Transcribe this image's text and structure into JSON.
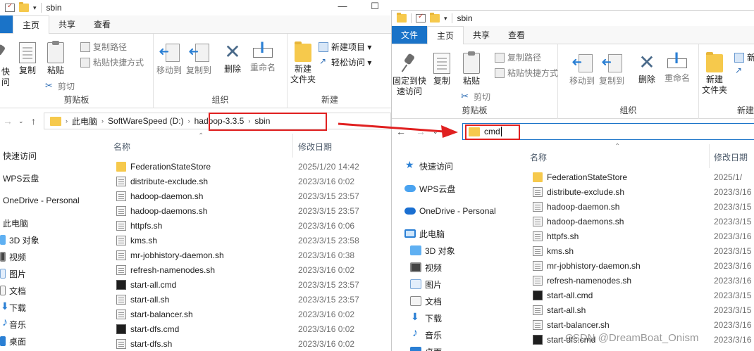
{
  "left_window": {
    "title": "sbin",
    "tabs": [
      "主页",
      "共享",
      "查看"
    ],
    "ribbon": {
      "clipboard": {
        "pin_label": "快\n问",
        "copy": "复制",
        "paste": "粘贴",
        "copy_path": "复制路径",
        "paste_shortcut": "粘贴快捷方式",
        "cut": "剪切",
        "group": "剪贴板"
      },
      "organize": {
        "move_to": "移动到",
        "copy_to": "复制到",
        "delete": "删除",
        "rename": "重命名",
        "group": "组织"
      },
      "new": {
        "new_folder": "新建\n文件夹",
        "new_item": "新建项目 ▾",
        "easy_access": "轻松访问 ▾",
        "group": "新建"
      }
    },
    "address": {
      "crumbs": [
        "此电脑",
        "SoftWareSpeed (D:)",
        "hadoop-3.3.5",
        "sbin"
      ]
    },
    "nav": [
      "快速访问",
      "WPS云盘",
      "OneDrive - Personal",
      "此电脑",
      "3D 对象",
      "视频",
      "图片",
      "文档",
      "下载",
      "音乐",
      "桌面"
    ],
    "columns": {
      "name": "名称",
      "date": "修改日期"
    },
    "files": [
      {
        "name": "FederationStateStore",
        "date": "2025/1/20 14:42",
        "type": "folder"
      },
      {
        "name": "distribute-exclude.sh",
        "date": "2023/3/16 0:02",
        "type": "sh"
      },
      {
        "name": "hadoop-daemon.sh",
        "date": "2023/3/15 23:57",
        "type": "sh"
      },
      {
        "name": "hadoop-daemons.sh",
        "date": "2023/3/15 23:57",
        "type": "sh"
      },
      {
        "name": "httpfs.sh",
        "date": "2023/3/16 0:06",
        "type": "sh"
      },
      {
        "name": "kms.sh",
        "date": "2023/3/15 23:58",
        "type": "sh"
      },
      {
        "name": "mr-jobhistory-daemon.sh",
        "date": "2023/3/16 0:38",
        "type": "sh"
      },
      {
        "name": "refresh-namenodes.sh",
        "date": "2023/3/16 0:02",
        "type": "sh"
      },
      {
        "name": "start-all.cmd",
        "date": "2023/3/15 23:57",
        "type": "cmd"
      },
      {
        "name": "start-all.sh",
        "date": "2023/3/15 23:57",
        "type": "sh"
      },
      {
        "name": "start-balancer.sh",
        "date": "2023/3/16 0:02",
        "type": "sh"
      },
      {
        "name": "start-dfs.cmd",
        "date": "2023/3/16 0:02",
        "type": "cmd"
      },
      {
        "name": "start-dfs.sh",
        "date": "2023/3/16 0:02",
        "type": "sh"
      }
    ]
  },
  "right_window": {
    "title": "sbin",
    "tabs": [
      "文件",
      "主页",
      "共享",
      "查看"
    ],
    "ribbon": {
      "clipboard": {
        "pin": "固定到快\n速访问",
        "copy": "复制",
        "paste": "粘贴",
        "copy_path": "复制路径",
        "paste_shortcut": "粘贴快捷方式",
        "cut": "剪切",
        "group": "剪贴板"
      },
      "organize": {
        "move_to": "移动到",
        "copy_to": "复制到",
        "delete": "删除",
        "rename": "重命名",
        "group": "组织"
      },
      "new": {
        "new_folder": "新建\n文件夹",
        "new_item": "新",
        "group": "新建"
      }
    },
    "address_value": "cmd",
    "nav": [
      "快速访问",
      "WPS云盘",
      "OneDrive - Personal",
      "此电脑",
      "3D 对象",
      "视频",
      "图片",
      "文档",
      "下载",
      "音乐",
      "桌面"
    ],
    "columns": {
      "name": "名称",
      "date": "修改日期"
    },
    "files": [
      {
        "name": "FederationStateStore",
        "date": "2025/1/",
        "type": "folder"
      },
      {
        "name": "distribute-exclude.sh",
        "date": "2023/3/16",
        "type": "sh"
      },
      {
        "name": "hadoop-daemon.sh",
        "date": "2023/3/15",
        "type": "sh"
      },
      {
        "name": "hadoop-daemons.sh",
        "date": "2023/3/15",
        "type": "sh"
      },
      {
        "name": "httpfs.sh",
        "date": "2023/3/16",
        "type": "sh"
      },
      {
        "name": "kms.sh",
        "date": "2023/3/15",
        "type": "sh"
      },
      {
        "name": "mr-jobhistory-daemon.sh",
        "date": "2023/3/16",
        "type": "sh"
      },
      {
        "name": "refresh-namenodes.sh",
        "date": "2023/3/16",
        "type": "sh"
      },
      {
        "name": "start-all.cmd",
        "date": "2023/3/15",
        "type": "cmd"
      },
      {
        "name": "start-all.sh",
        "date": "2023/3/15",
        "type": "sh"
      },
      {
        "name": "start-balancer.sh",
        "date": "2023/3/16",
        "type": "sh"
      },
      {
        "name": "start-dfs.cmd",
        "date": "2023/3/16",
        "type": "cmd"
      }
    ]
  },
  "watermark": "CSDN @DreamBoat_Onism",
  "colors": {
    "accent": "#1a73c8",
    "highlight": "#e02020",
    "folder": "#f6c94c"
  }
}
